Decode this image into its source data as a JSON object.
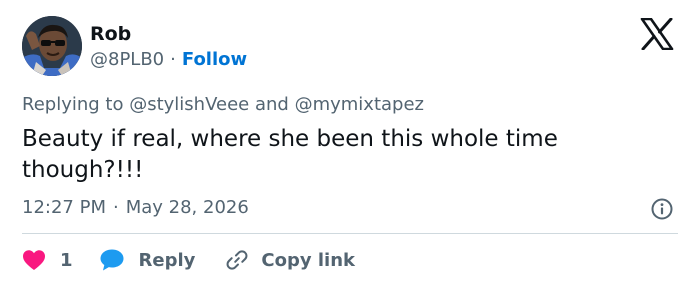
{
  "author": {
    "name": "Rob",
    "handle": "@8PLB0",
    "separator": "·",
    "follow_label": "Follow"
  },
  "reply_context": {
    "prefix": "Replying to",
    "mention_1": "@stylishVeee",
    "conjunction": "and",
    "mention_2": "@mymixtapez"
  },
  "tweet": {
    "text": "Beauty if real, where she been this whole time though?!!!"
  },
  "meta": {
    "time": "12:27 PM",
    "separator": "·",
    "date": "May 28, 2026"
  },
  "actions": {
    "like_count": "1",
    "reply_label": "Reply",
    "copy_label": "Copy link"
  },
  "icons": {
    "brand": "x-logo-icon",
    "info": "info-icon",
    "like": "heart-icon",
    "reply": "speech-bubble-icon",
    "copy": "link-icon"
  },
  "colors": {
    "text": "#0f1419",
    "secondary": "#536471",
    "link": "#0074d4",
    "like": "#f91880",
    "reply": "#1d9bf0",
    "divider": "#cfd9de"
  }
}
